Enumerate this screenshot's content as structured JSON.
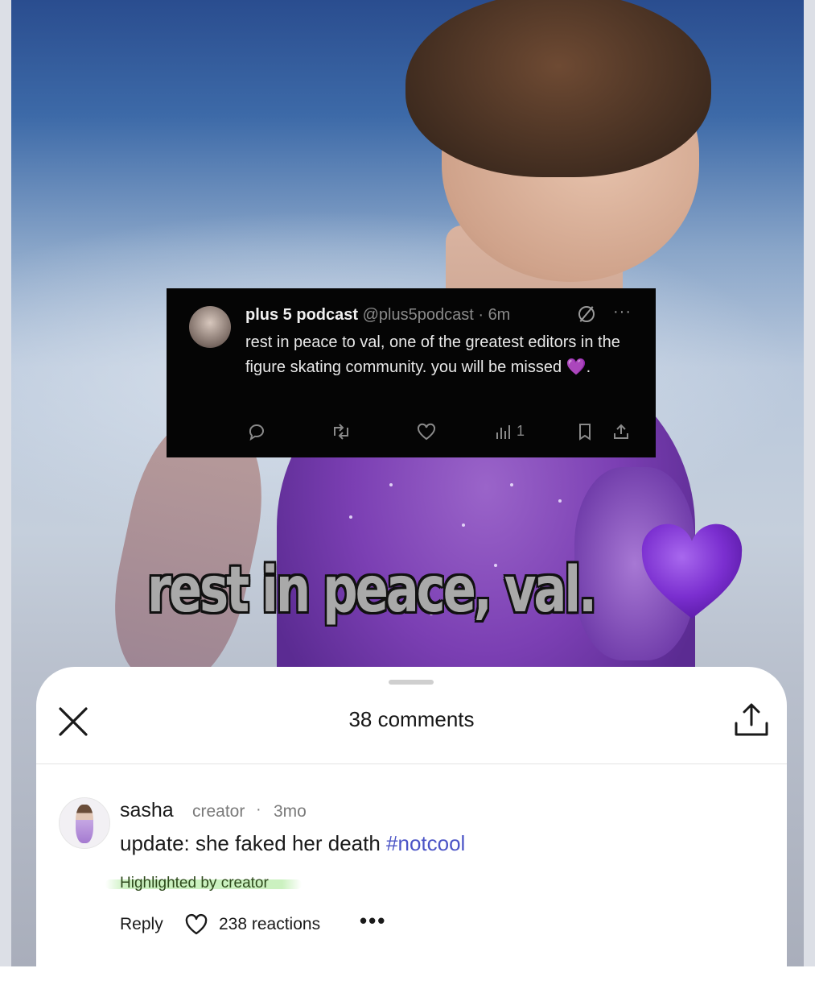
{
  "tweet": {
    "name": "plus 5 podcast",
    "handle": "@plus5podcast",
    "separator": "·",
    "time": "6m",
    "more": "···",
    "text": "rest in peace to val, one of the greatest editors in the figure skating community. you will be missed",
    "text_suffix_heart": "💜",
    "text_end": ".",
    "views_count": "1"
  },
  "caption": {
    "text": "rest in peace, val.",
    "heart_color": "#7b2fd0"
  },
  "sheet": {
    "title": "38 comments"
  },
  "comment": {
    "user": "sasha",
    "role": "creator",
    "separator": "·",
    "time": "3mo",
    "text": "update: she faked her death ",
    "hashtag": "#notcool",
    "highlight": "Highlighted by creator",
    "reply": "Reply",
    "reactions": "238 reactions",
    "more": "•••"
  },
  "colors": {
    "hashtag": "#4b54c6",
    "highlight_mark": "#a0e68c"
  }
}
